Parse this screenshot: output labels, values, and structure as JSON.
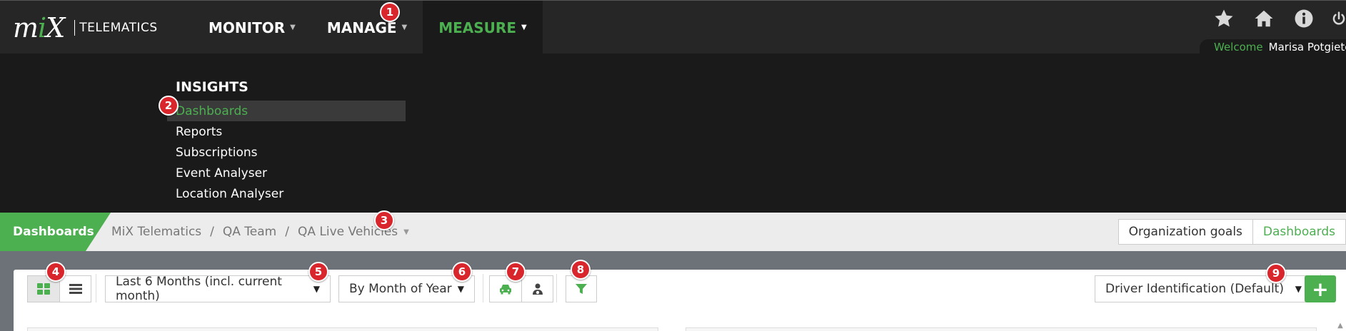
{
  "app": {
    "logo_mark": "mix",
    "logo_text": "TELEMATICS",
    "accent_color": "#4caf50",
    "badge_color": "#d9262c"
  },
  "nav": {
    "items": [
      {
        "label": "MONITOR",
        "active": false
      },
      {
        "label": "MANAGE",
        "active": false
      },
      {
        "label": "MEASURE",
        "active": true
      }
    ]
  },
  "top_icons": [
    "star-icon",
    "home-icon",
    "info-icon",
    "power-icon"
  ],
  "welcome": {
    "label": "Welcome",
    "user": "Marisa Potgieter"
  },
  "dropdown": {
    "heading": "INSIGHTS",
    "items": [
      {
        "label": "Dashboards",
        "selected": true
      },
      {
        "label": "Reports"
      },
      {
        "label": "Subscriptions"
      },
      {
        "label": "Event Analyser"
      },
      {
        "label": "Location Analyser"
      }
    ]
  },
  "breadcrumb": {
    "section": "Dashboards",
    "items": [
      "MiX Telematics",
      "QA Team",
      "QA Live Vehicles"
    ],
    "separator": "/",
    "tabs": [
      {
        "label": "Organization goals",
        "active": false
      },
      {
        "label": "Dashboards",
        "active": true
      }
    ]
  },
  "toolbar": {
    "view_toggle_icons": [
      "grid-view-icon",
      "list-view-icon"
    ],
    "period_select": "Last 6 Months (incl. current month)",
    "grouping_select": "By Month of Year",
    "entity_toggle_icons": [
      "vehicle-icon",
      "driver-icon"
    ],
    "filter_icon": "filter-icon",
    "identification_select": "Driver Identification (Default)",
    "add_label": "+"
  },
  "badges": [
    "1",
    "2",
    "3",
    "4",
    "5",
    "6",
    "7",
    "8",
    "9"
  ]
}
